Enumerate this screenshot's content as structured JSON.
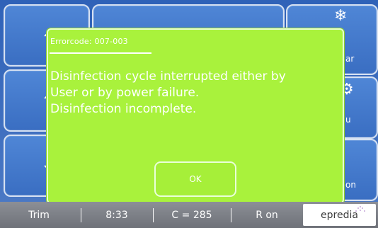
{
  "dialog": {
    "error_code": "Errorcode: 007-003",
    "message_lines": [
      "Disinfection cycle interrupted either by",
      "User or by power failure.",
      "Disinfection incomplete."
    ],
    "ok_label": "OK"
  },
  "background_tiles": {
    "right_top_label": "ar",
    "right_mid_label": "u",
    "right_bottom_label": "on"
  },
  "statusbar": {
    "trim": "Trim",
    "time": "8:33",
    "counter": "C = 285",
    "r_status": "R on",
    "logo_text": "epredia"
  },
  "colors": {
    "dialog_bg": "#a9f23c",
    "screen_blue": "#3a6ec2",
    "statusbar_gray": "#7e8188"
  },
  "icons": {
    "chevron_up": "chevron-up-icon",
    "chevron_down": "chevron-down-icon",
    "snowflake": "snowflake-icon",
    "gear": "gear-icon"
  }
}
